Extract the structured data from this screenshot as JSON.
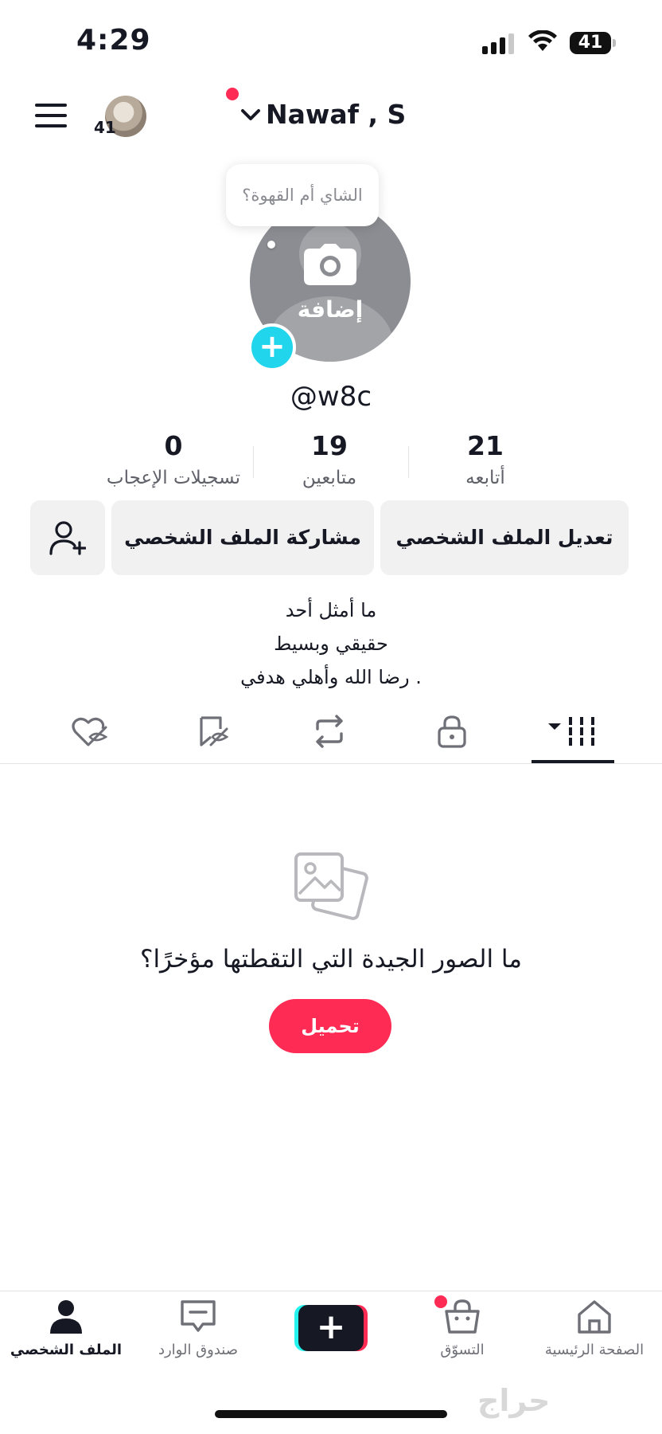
{
  "status_bar": {
    "time": "4:29",
    "battery": "41"
  },
  "header": {
    "avatar_badge": "41",
    "username": "Nawaf , S"
  },
  "profile": {
    "bubble_text": "الشاي أم القهوة؟",
    "add_photo_label": "إضافة",
    "handle": "@w8c"
  },
  "stats": [
    {
      "value": "21",
      "label": "أتابعه"
    },
    {
      "value": "19",
      "label": "متابعين"
    },
    {
      "value": "0",
      "label": "تسجيلات الإعجاب"
    }
  ],
  "buttons": {
    "edit_profile": "تعديل الملف الشخصي",
    "share_profile": "مشاركة الملف الشخصي"
  },
  "bio": [
    "ما أمثل أحد",
    "حقيقي وبسيط",
    "رضا الله وأهلي هدفي ."
  ],
  "tabs": [
    "videos-icon",
    "lock-icon",
    "repost-icon",
    "bookmark-icon",
    "liked-icon"
  ],
  "empty_state": {
    "message": "ما الصور الجيدة التي التقطتها مؤخرًا؟",
    "upload_label": "تحميل"
  },
  "bottom_nav": {
    "home": "الصفحة الرئيسية",
    "shop": "التسوّق",
    "inbox": "صندوق الوارد",
    "profile": "الملف الشخصي"
  },
  "watermark": "حراج",
  "colors": {
    "accent": "#fe2c55",
    "cyan": "#20d5ec",
    "text": "#161823"
  }
}
